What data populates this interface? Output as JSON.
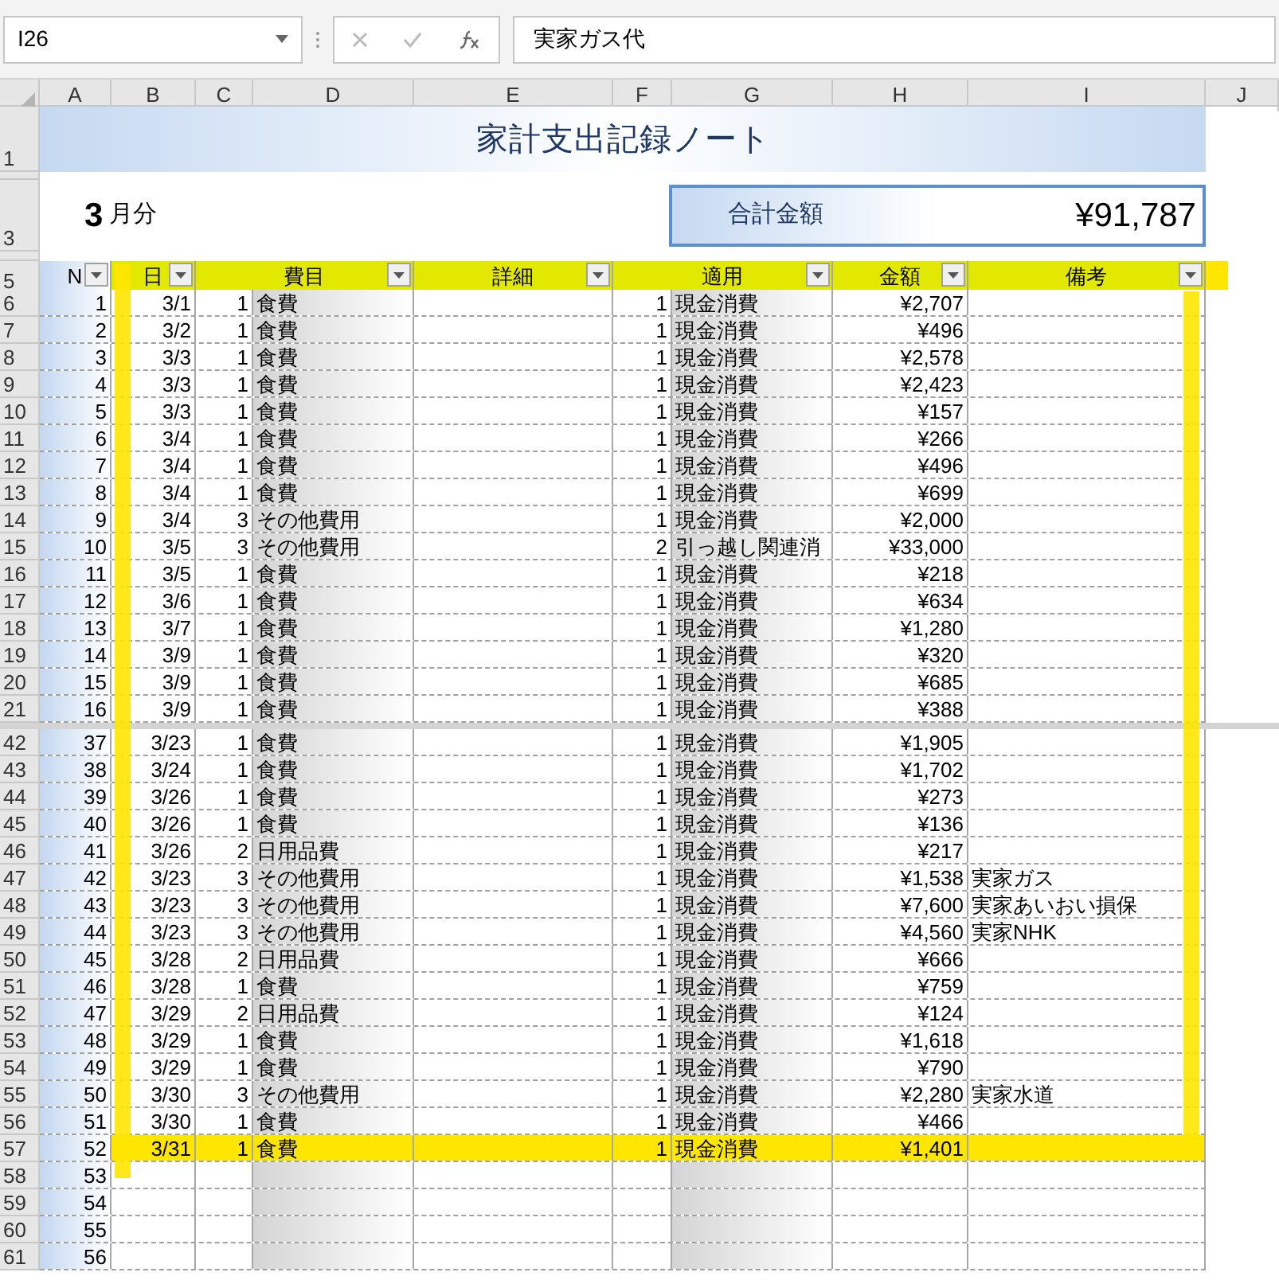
{
  "formula_bar": {
    "name_box": "I26",
    "formula": "実家ガス代"
  },
  "column_headers": [
    "A",
    "B",
    "C",
    "D",
    "E",
    "F",
    "G",
    "H",
    "I",
    "J"
  ],
  "title": {
    "row": "1",
    "text": "家計支出記録ノート"
  },
  "month": {
    "row": "3",
    "number": "3",
    "unit": "月分"
  },
  "total": {
    "label": "合計金額",
    "value": "¥91,787"
  },
  "table_header": {
    "row": "5",
    "columns": [
      "N",
      "日",
      "費目",
      "詳細",
      "適用",
      "金額",
      "備考"
    ]
  },
  "rows_top": [
    {
      "row": "6",
      "no": "1",
      "date": "3/1",
      "cat_code": "1",
      "category": "食費",
      "pay_code": "1",
      "payment": "現金消費",
      "amount": "¥2,707",
      "highlighted": false
    },
    {
      "row": "7",
      "no": "2",
      "date": "3/2",
      "cat_code": "1",
      "category": "食費",
      "pay_code": "1",
      "payment": "現金消費",
      "amount": "¥496",
      "highlighted": false
    },
    {
      "row": "8",
      "no": "3",
      "date": "3/3",
      "cat_code": "1",
      "category": "食費",
      "pay_code": "1",
      "payment": "現金消費",
      "amount": "¥2,578",
      "highlighted": false
    },
    {
      "row": "9",
      "no": "4",
      "date": "3/3",
      "cat_code": "1",
      "category": "食費",
      "pay_code": "1",
      "payment": "現金消費",
      "amount": "¥2,423",
      "highlighted": false
    },
    {
      "row": "10",
      "no": "5",
      "date": "3/3",
      "cat_code": "1",
      "category": "食費",
      "pay_code": "1",
      "payment": "現金消費",
      "amount": "¥157",
      "highlighted": false
    },
    {
      "row": "11",
      "no": "6",
      "date": "3/4",
      "cat_code": "1",
      "category": "食費",
      "pay_code": "1",
      "payment": "現金消費",
      "amount": "¥266",
      "highlighted": false
    },
    {
      "row": "12",
      "no": "7",
      "date": "3/4",
      "cat_code": "1",
      "category": "食費",
      "pay_code": "1",
      "payment": "現金消費",
      "amount": "¥496",
      "highlighted": false
    },
    {
      "row": "13",
      "no": "8",
      "date": "3/4",
      "cat_code": "1",
      "category": "食費",
      "pay_code": "1",
      "payment": "現金消費",
      "amount": "¥699",
      "highlighted": false
    },
    {
      "row": "14",
      "no": "9",
      "date": "3/4",
      "cat_code": "3",
      "category": "その他費用",
      "pay_code": "1",
      "payment": "現金消費",
      "amount": "¥2,000",
      "highlighted": false
    },
    {
      "row": "15",
      "no": "10",
      "date": "3/5",
      "cat_code": "3",
      "category": "その他費用",
      "pay_code": "2",
      "payment": "引っ越し関連消",
      "amount": "¥33,000",
      "highlighted": false
    },
    {
      "row": "16",
      "no": "11",
      "date": "3/5",
      "cat_code": "1",
      "category": "食費",
      "pay_code": "1",
      "payment": "現金消費",
      "amount": "¥218",
      "highlighted": false
    },
    {
      "row": "17",
      "no": "12",
      "date": "3/6",
      "cat_code": "1",
      "category": "食費",
      "pay_code": "1",
      "payment": "現金消費",
      "amount": "¥634",
      "highlighted": false
    },
    {
      "row": "18",
      "no": "13",
      "date": "3/7",
      "cat_code": "1",
      "category": "食費",
      "pay_code": "1",
      "payment": "現金消費",
      "amount": "¥1,280",
      "highlighted": false
    },
    {
      "row": "19",
      "no": "14",
      "date": "3/9",
      "cat_code": "1",
      "category": "食費",
      "pay_code": "1",
      "payment": "現金消費",
      "amount": "¥320",
      "highlighted": false
    },
    {
      "row": "20",
      "no": "15",
      "date": "3/9",
      "cat_code": "1",
      "category": "食費",
      "pay_code": "1",
      "payment": "現金消費",
      "amount": "¥685",
      "highlighted": false
    },
    {
      "row": "21",
      "no": "16",
      "date": "3/9",
      "cat_code": "1",
      "category": "食費",
      "pay_code": "1",
      "payment": "現金消費",
      "amount": "¥388",
      "highlighted": false
    }
  ],
  "rows_bottom": [
    {
      "row": "42",
      "no": "37",
      "date": "3/23",
      "cat_code": "1",
      "category": "食費",
      "pay_code": "1",
      "payment": "現金消費",
      "amount": "¥1,905",
      "highlighted": false
    },
    {
      "row": "43",
      "no": "38",
      "date": "3/24",
      "cat_code": "1",
      "category": "食費",
      "pay_code": "1",
      "payment": "現金消費",
      "amount": "¥1,702",
      "highlighted": false
    },
    {
      "row": "44",
      "no": "39",
      "date": "3/26",
      "cat_code": "1",
      "category": "食費",
      "pay_code": "1",
      "payment": "現金消費",
      "amount": "¥273",
      "highlighted": false
    },
    {
      "row": "45",
      "no": "40",
      "date": "3/26",
      "cat_code": "1",
      "category": "食費",
      "pay_code": "1",
      "payment": "現金消費",
      "amount": "¥136",
      "highlighted": false
    },
    {
      "row": "46",
      "no": "41",
      "date": "3/26",
      "cat_code": "2",
      "category": "日用品費",
      "pay_code": "1",
      "payment": "現金消費",
      "amount": "¥217",
      "highlighted": false
    },
    {
      "row": "47",
      "no": "42",
      "date": "3/23",
      "cat_code": "3",
      "category": "その他費用",
      "pay_code": "1",
      "payment": "現金消費",
      "amount": "¥1,538",
      "note": "実家ガス",
      "highlighted": false
    },
    {
      "row": "48",
      "no": "43",
      "date": "3/23",
      "cat_code": "3",
      "category": "その他費用",
      "pay_code": "1",
      "payment": "現金消費",
      "amount": "¥7,600",
      "note": "実家あいおい損保",
      "highlighted": false
    },
    {
      "row": "49",
      "no": "44",
      "date": "3/23",
      "cat_code": "3",
      "category": "その他費用",
      "pay_code": "1",
      "payment": "現金消費",
      "amount": "¥4,560",
      "note": "実家NHK",
      "highlighted": false
    },
    {
      "row": "50",
      "no": "45",
      "date": "3/28",
      "cat_code": "2",
      "category": "日用品費",
      "pay_code": "1",
      "payment": "現金消費",
      "amount": "¥666",
      "highlighted": false
    },
    {
      "row": "51",
      "no": "46",
      "date": "3/28",
      "cat_code": "1",
      "category": "食費",
      "pay_code": "1",
      "payment": "現金消費",
      "amount": "¥759",
      "highlighted": false
    },
    {
      "row": "52",
      "no": "47",
      "date": "3/29",
      "cat_code": "2",
      "category": "日用品費",
      "pay_code": "1",
      "payment": "現金消費",
      "amount": "¥124",
      "highlighted": false
    },
    {
      "row": "53",
      "no": "48",
      "date": "3/29",
      "cat_code": "1",
      "category": "食費",
      "pay_code": "1",
      "payment": "現金消費",
      "amount": "¥1,618",
      "highlighted": false
    },
    {
      "row": "54",
      "no": "49",
      "date": "3/29",
      "cat_code": "1",
      "category": "食費",
      "pay_code": "1",
      "payment": "現金消費",
      "amount": "¥790",
      "highlighted": false
    },
    {
      "row": "55",
      "no": "50",
      "date": "3/30",
      "cat_code": "3",
      "category": "その他費用",
      "pay_code": "1",
      "payment": "現金消費",
      "amount": "¥2,280",
      "note": "実家水道",
      "highlighted": false
    },
    {
      "row": "56",
      "no": "51",
      "date": "3/30",
      "cat_code": "1",
      "category": "食費",
      "pay_code": "1",
      "payment": "現金消費",
      "amount": "¥466",
      "highlighted": false
    },
    {
      "row": "57",
      "no": "52",
      "date": "3/31",
      "cat_code": "1",
      "category": "食費",
      "pay_code": "1",
      "payment": "現金消費",
      "amount": "¥1,401",
      "highlighted": true
    },
    {
      "row": "58",
      "no": "53"
    },
    {
      "row": "59",
      "no": "54"
    },
    {
      "row": "60",
      "no": "55"
    },
    {
      "row": "61",
      "no": "56"
    }
  ]
}
